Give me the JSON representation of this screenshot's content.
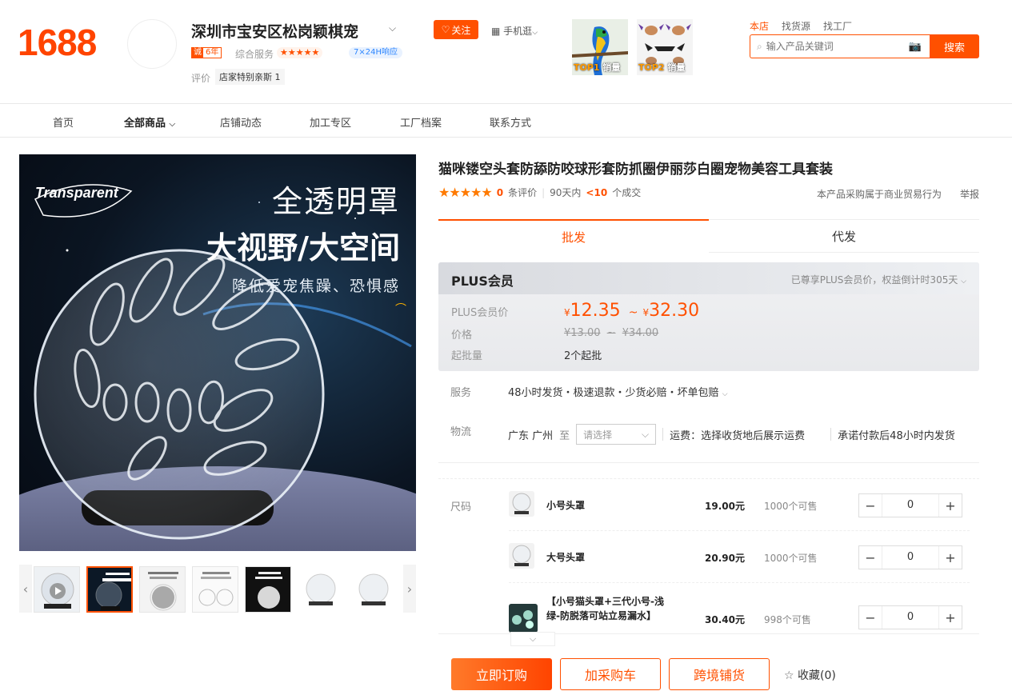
{
  "header": {
    "logo": "1688",
    "shop_name": "深圳市宝安区松岗颖棋宠",
    "years_badge": "诚",
    "years_text": "6年",
    "service_label": "综合服务",
    "service_stars": "★★★★★",
    "response_badge": "7×24H响应",
    "eval_label": "评价",
    "eval_tag": "店家特别亲斯 1",
    "follow_label": "关注",
    "mobile_label": "手机逛",
    "top_items": [
      {
        "rank": "TOP1",
        "label": "销量"
      },
      {
        "rank": "TOP2",
        "label": "销量"
      }
    ],
    "search_scopes": [
      "本店",
      "找货源",
      "找工厂"
    ],
    "search_placeholder": "输入产品关键词",
    "search_button": "搜索"
  },
  "nav": {
    "items": [
      "首页",
      "全部商品",
      "店铺动态",
      "加工专区",
      "工厂档案",
      "联系方式"
    ]
  },
  "main_image": {
    "brand_text": "Transparent",
    "headline": "全透明罩",
    "subheadline": "大视野/大空间",
    "caption": "降低爱宠焦躁、恐惧感"
  },
  "product": {
    "title": "猫咪镂空头套防舔防咬球形套防抓圈伊丽莎白圈宠物美容工具套装",
    "stars": "★★★★★",
    "review_count": "0",
    "review_label": "条评价",
    "deal_period": "90天内",
    "deal_count": "<10",
    "deal_label": "个成交",
    "biz_note": "本产品采购属于商业贸易行为",
    "report": "举报"
  },
  "tabs": [
    "批发",
    "代发"
  ],
  "plus": {
    "title": "PLUS会员",
    "note": "已尊享PLUS会员价，权益倒计时305天",
    "member_price_label": "PLUS会员价",
    "currency": "¥",
    "price_low": "12.35",
    "price_sep": "~",
    "price_high": "32.30",
    "price_label": "价格",
    "orig_low": "¥13.00",
    "orig_high": "¥34.00",
    "moq_label": "起批量",
    "moq_value": "2个起批"
  },
  "service": {
    "label": "服务",
    "value": "48小时发货・极速退款・少货必赔・坏单包赔"
  },
  "logistics": {
    "label": "物流",
    "origin": "广东 广州",
    "to": "至",
    "select_placeholder": "请选择",
    "fee": "运费：选择收货地后展示运费",
    "promise": "承诺付款后48小时内发货"
  },
  "sku": {
    "label": "尺码",
    "items": [
      {
        "name": "小号头罩",
        "price": "19.00元",
        "stock": "1000个可售",
        "qty": "0"
      },
      {
        "name": "大号头罩",
        "price": "20.90元",
        "stock": "1000个可售",
        "qty": "0"
      },
      {
        "name": "【小号猫头罩+三代小号-浅绿-防脱落可站立易漏水】",
        "price": "30.40元",
        "stock": "998个可售",
        "qty": "0"
      }
    ]
  },
  "actions": {
    "buy": "立即订购",
    "cart": "加采购车",
    "cross": "跨境铺货",
    "favorite": "收藏(0)"
  },
  "colors": {
    "accent": "#ff5000",
    "price": "#ff5000"
  }
}
